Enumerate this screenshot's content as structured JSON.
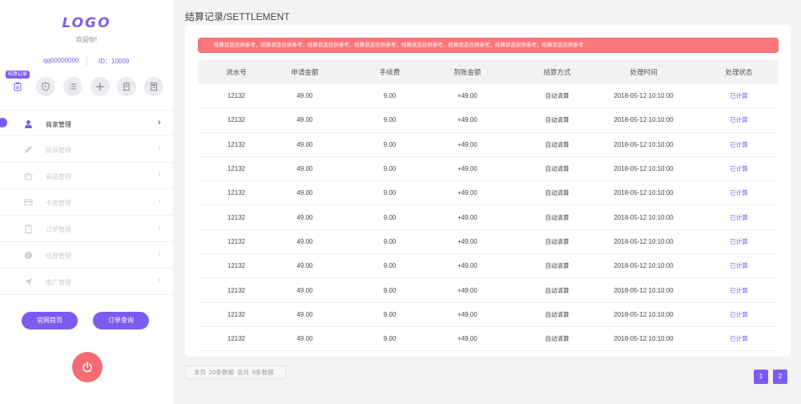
{
  "sidebar": {
    "logo": "LOGO",
    "welcome": "欢迎你!",
    "qq": "qq00000000",
    "id": "ID：10009",
    "quick_tip": "结算记录",
    "quick_icons": [
      "clipboard-icon",
      "shield-icon",
      "list-icon",
      "plus-icon",
      "document-icon",
      "calculator-icon"
    ],
    "menu": [
      {
        "label": "商家管理",
        "icon": "user-icon",
        "active": true
      },
      {
        "label": "投诉管理",
        "icon": "pencil-icon",
        "active": false
      },
      {
        "label": "商品管理",
        "icon": "basket-icon",
        "active": false
      },
      {
        "label": "卡密管理",
        "icon": "card-icon",
        "active": false
      },
      {
        "label": "订单管理",
        "icon": "clipboard-icon",
        "active": false
      },
      {
        "label": "结算管理",
        "icon": "coin-icon",
        "active": false
      },
      {
        "label": "推广管理",
        "icon": "send-icon",
        "active": false
      }
    ],
    "home_button": "官网首页",
    "order_button": "订单查询"
  },
  "main": {
    "title": "结算记录/SETTLEMENT",
    "notice": "结算状态仅供参考，结算状态仅供参考，结算状态仅供参考，结算状态仅供参考，结算状态仅供参考，结算状态仅供参考，结算状态仅供参考，结算状态仅供参考",
    "columns": [
      "流水号",
      "申请金额",
      "手续费",
      "到账金额",
      "结算方式",
      "处理时间",
      "处理状态"
    ],
    "rows": [
      [
        "12132",
        "49.00",
        "9.00",
        "+49.00",
        "自动清算",
        "2018-05-12   10:10:00",
        "已计算"
      ],
      [
        "12132",
        "49.00",
        "9.00",
        "+49.00",
        "自动清算",
        "2018-05-12   10:10:00",
        "已计算"
      ],
      [
        "12132",
        "49.00",
        "9.00",
        "+49.00",
        "自动清算",
        "2018-05-12   10:10:00",
        "已计算"
      ],
      [
        "12132",
        "49.00",
        "9.00",
        "+49.00",
        "自动清算",
        "2018-05-12   10:10:00",
        "已计算"
      ],
      [
        "12132",
        "49.00",
        "9.00",
        "+49.00",
        "自动清算",
        "2018-05-12   10:10:00",
        "已计算"
      ],
      [
        "12132",
        "49.00",
        "9.00",
        "+49.00",
        "自动清算",
        "2018-05-12   10:10:00",
        "已计算"
      ],
      [
        "12132",
        "49.00",
        "9.00",
        "+49.00",
        "自动清算",
        "2018-05-12   10:10:00",
        "已计算"
      ],
      [
        "12132",
        "49.00",
        "9.00",
        "+49.00",
        "自动清算",
        "2018-05-12   10:10:00",
        "已计算"
      ],
      [
        "12132",
        "49.00",
        "9.00",
        "+49.00",
        "自动清算",
        "2018-05-12   10:10:00",
        "已计算"
      ],
      [
        "12132",
        "49.00",
        "9.00",
        "+49.00",
        "自动清算",
        "2018-05-12   10:10:00",
        "已计算"
      ],
      [
        "12132",
        "49.00",
        "9.00",
        "+49.00",
        "自动清算",
        "2018-05-12   10:10:00",
        "已计算"
      ]
    ],
    "page_info": {
      "label_page": "本页",
      "page_count": "20条数据",
      "label_total": "总共",
      "total_count": "9条数据"
    },
    "pages": [
      "1",
      "2"
    ]
  },
  "colors": {
    "accent": "#7b5cf0",
    "notice": "#f8777b",
    "power": "#f46c72"
  }
}
